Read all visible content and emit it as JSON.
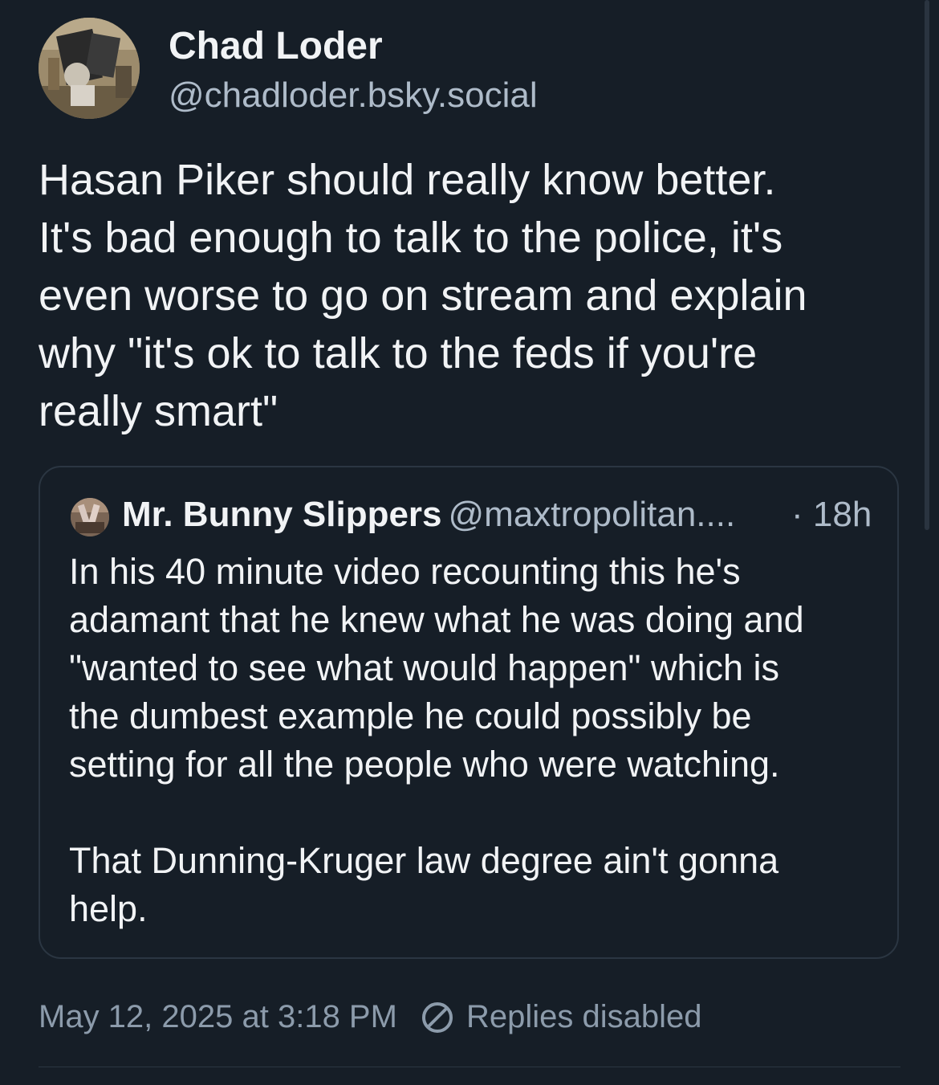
{
  "author": {
    "name": "Chad Loder",
    "handle": "@chadloder.bsky.social",
    "avatar_icon": "profile-photo"
  },
  "post": {
    "text": "Hasan Piker should really know better.\nIt's bad enough to talk to the police, it's\neven worse to go on stream and explain\nwhy \"it's ok to talk to the feds if you're\nreally smart\""
  },
  "quote": {
    "name": "Mr. Bunny Slippers",
    "handle": "@maxtropolitan....",
    "time": "· 18h",
    "avatar_icon": "profile-photo",
    "text": "In his 40 minute video recounting this he's\nadamant that he knew what he was doing and\n\"wanted to see what would happen\" which is\nthe dumbest example he could possibly be\nsetting for all the people who were watching.\n\nThat Dunning-Kruger law degree ain't gonna\nhelp."
  },
  "meta": {
    "timestamp": "May 12, 2025 at 3:18 PM",
    "replies_status": "Replies disabled",
    "replies_icon": "no-entry-icon"
  },
  "colors": {
    "background": "#161e27",
    "text_primary": "#f1f3f5",
    "text_secondary": "#aebbc9",
    "border": "#2b3642"
  }
}
